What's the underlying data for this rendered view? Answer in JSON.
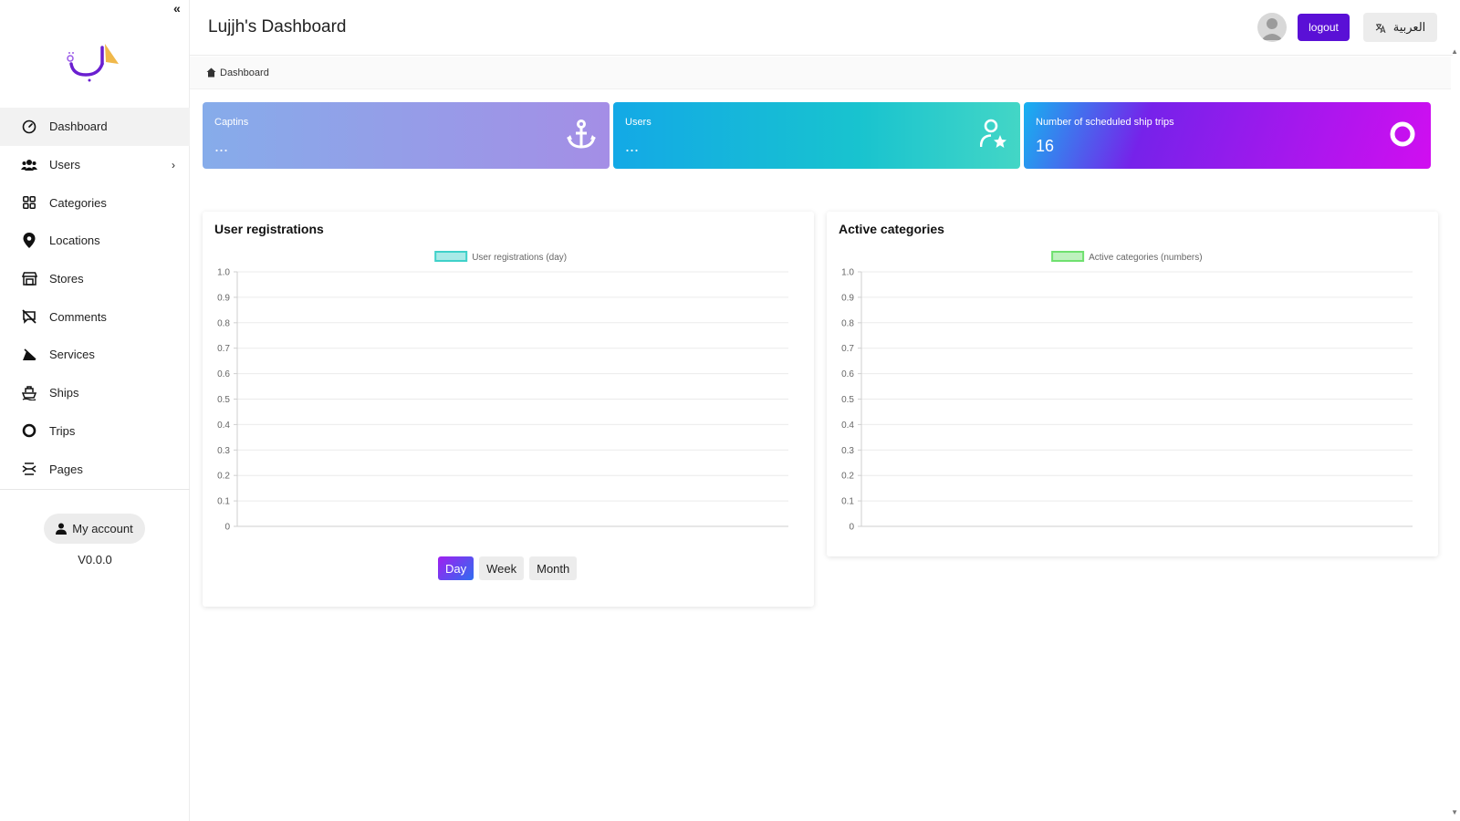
{
  "header": {
    "title": "Lujjh's Dashboard",
    "logout_label": "logout",
    "lang_label": "العربية"
  },
  "breadcrumb": {
    "current": "Dashboard"
  },
  "sidebar": {
    "items": [
      {
        "label": "Dashboard",
        "icon": "gauge-icon"
      },
      {
        "label": "Users",
        "icon": "users-icon"
      },
      {
        "label": "Categories",
        "icon": "grid-icon"
      },
      {
        "label": "Locations",
        "icon": "map-pin-icon"
      },
      {
        "label": "Stores",
        "icon": "store-icon"
      },
      {
        "label": "Comments",
        "icon": "comment-off-icon"
      },
      {
        "label": "Services",
        "icon": "services-icon"
      },
      {
        "label": "Ships",
        "icon": "ship-icon"
      },
      {
        "label": "Trips",
        "icon": "circle-icon"
      },
      {
        "label": "Pages",
        "icon": "pages-icon"
      }
    ],
    "account_label": "My account",
    "version": "V0.0.0"
  },
  "stats": {
    "captins": {
      "label": "Captins",
      "value": "...",
      "icon": "anchor-icon"
    },
    "users": {
      "label": "Users",
      "value": "...",
      "icon": "user-star-icon"
    },
    "trips": {
      "label": "Number of scheduled ship trips",
      "value": "16",
      "icon": "ring-icon"
    }
  },
  "panels": {
    "registrations": {
      "title": "User registrations"
    },
    "categories": {
      "title": "Active categories"
    }
  },
  "range_buttons": [
    "Day",
    "Week",
    "Month"
  ],
  "colors": {
    "accent": "#5a10d6",
    "reg_series": "#3fd1c9",
    "cat_series": "#6fe06f"
  },
  "chart_data": [
    {
      "type": "bar",
      "title": "",
      "series": [
        {
          "name": "User registrations (day)",
          "values": []
        }
      ],
      "categories": [],
      "ylim": [
        0,
        1.0
      ],
      "yticks": [
        "0",
        "0.1",
        "0.2",
        "0.3",
        "0.4",
        "0.5",
        "0.6",
        "0.7",
        "0.8",
        "0.9",
        "1.0"
      ],
      "grid": true,
      "legend": "top-center"
    },
    {
      "type": "bar",
      "title": "",
      "series": [
        {
          "name": "Active categories (numbers)",
          "values": []
        }
      ],
      "categories": [],
      "ylim": [
        0,
        1.0
      ],
      "yticks": [
        "0",
        "0.1",
        "0.2",
        "0.3",
        "0.4",
        "0.5",
        "0.6",
        "0.7",
        "0.8",
        "0.9",
        "1.0"
      ],
      "grid": true,
      "legend": "top-center"
    }
  ]
}
